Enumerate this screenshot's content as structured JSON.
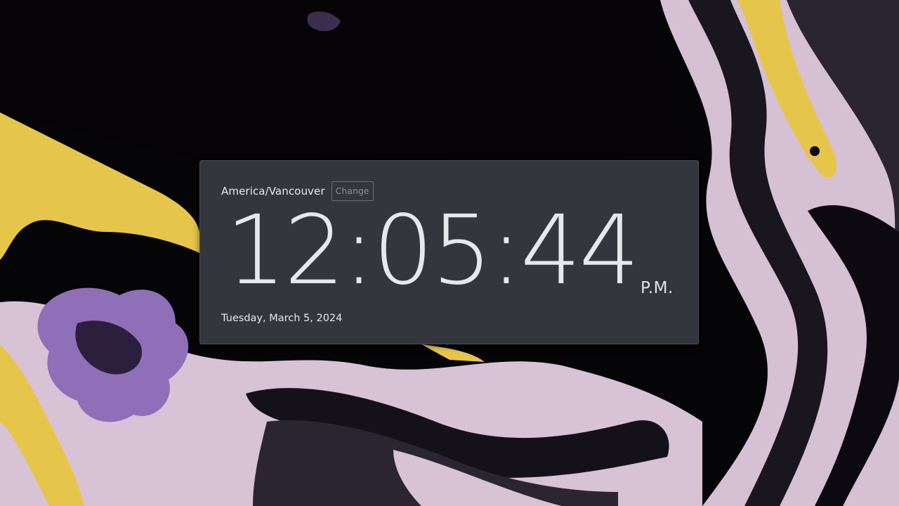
{
  "wallpaper": {
    "description_icon": "abstract-paint-wallpaper",
    "colors": {
      "base": "#050407",
      "lavender": "#d9c3d6",
      "yellow": "#e8c84a",
      "purple": "#8e6fb8",
      "gray": "#6a6a78"
    }
  },
  "clock": {
    "timezone": "America/Vancouver",
    "change_label": "Change",
    "time": "12:05:44",
    "period": "P.M.",
    "date": "Tuesday, March 5, 2024"
  },
  "colors": {
    "card_bg": "#33373d",
    "text": "#e6e8ec",
    "button_border": "#6b6f76",
    "button_text": "#8c9097"
  }
}
